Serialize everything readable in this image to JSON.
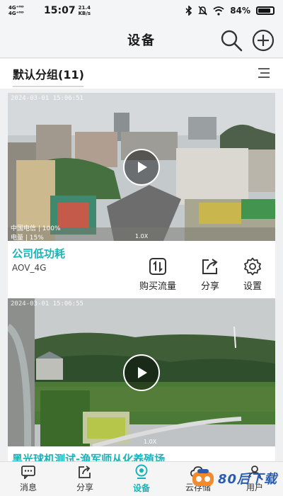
{
  "status_bar": {
    "network": [
      "4G⁺ᴴᴰ",
      "4G⁺ᴴᴰ"
    ],
    "time": "15:07",
    "speed_value": "21.4",
    "speed_unit": "KB/s",
    "battery": "84%",
    "battery_level": 0.84
  },
  "header": {
    "title": "设备"
  },
  "group": {
    "title": "默认分组(11)"
  },
  "devices": [
    {
      "timestamp": "2024-03-01 15:06:51",
      "carrier": "中国电信",
      "signal": "100%",
      "battery_label": "电量",
      "battery_value": "15%",
      "zoom": "1.0X",
      "name": "公司低功耗",
      "subtitle": "AOV_4G",
      "actions": [
        {
          "label": "购买流量",
          "icon": "traffic-icon"
        },
        {
          "label": "分享",
          "icon": "share-icon"
        },
        {
          "label": "设置",
          "icon": "gear-icon"
        }
      ]
    },
    {
      "timestamp": "2024-03-01 15:06:55",
      "zoom": "1.0X",
      "name": "黑光球机测试-渔军师从化养殖场"
    }
  ],
  "tabs": [
    {
      "label": "消息",
      "icon": "message-icon"
    },
    {
      "label": "分享",
      "icon": "share-icon"
    },
    {
      "label": "设备",
      "icon": "device-icon",
      "active": true
    },
    {
      "label": "云存储",
      "icon": "cloud-icon"
    },
    {
      "label": "用户",
      "icon": "user-icon"
    }
  ],
  "watermark": {
    "text": "80后下载"
  },
  "colors": {
    "accent": "#1ab3b7",
    "brand_watermark": "#2a5db0"
  }
}
